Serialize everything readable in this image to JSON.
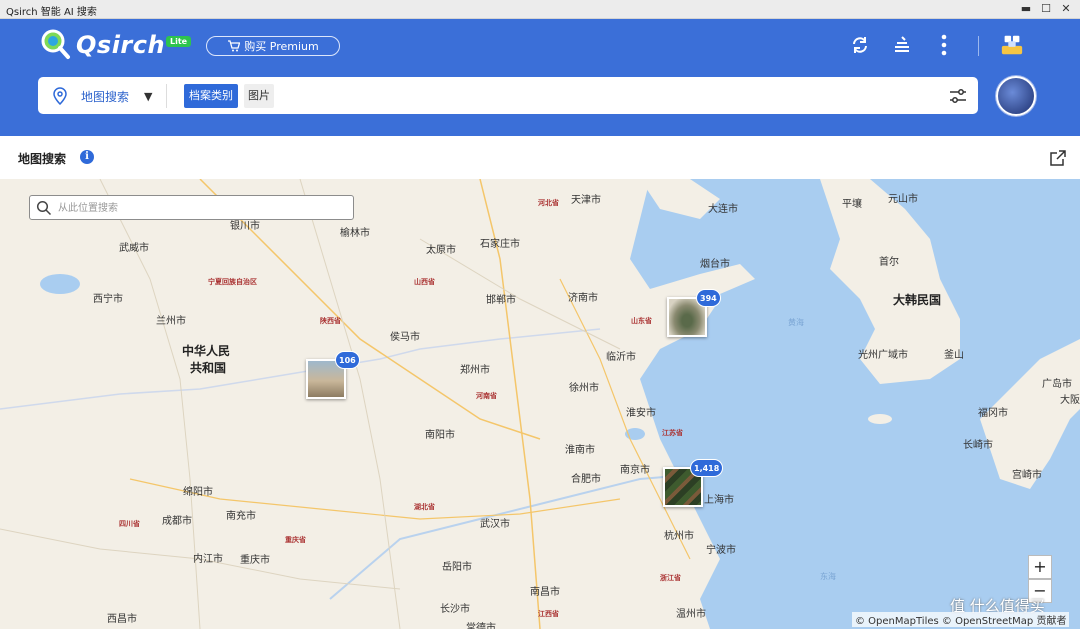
{
  "window": {
    "title": "Qsirch 智能 AI 搜索",
    "minimize": "▬",
    "maximize": "☐",
    "close": "✕"
  },
  "header": {
    "logo_text": "Qsirch",
    "lite_badge": "Lite",
    "premium_label": "购买 Premium",
    "icons": [
      "refresh-icon",
      "stack-icon",
      "more-icon",
      "app-store-icon"
    ]
  },
  "search": {
    "mode_label": "地图搜索",
    "chips": [
      {
        "label": "档案类别",
        "active": true
      },
      {
        "label": "图片",
        "active": false
      }
    ]
  },
  "map_panel": {
    "title": "地图搜索",
    "search_placeholder": "从此位置搜索",
    "clusters": [
      {
        "count": "106",
        "place": "cluster-shaanxi"
      },
      {
        "count": "394",
        "place": "cluster-shandong"
      },
      {
        "count": "1,418",
        "place": "cluster-shanghai"
      }
    ],
    "cities": [
      "天津市",
      "大连市",
      "元山市",
      "平壤",
      "银川市",
      "榆林市",
      "太原市",
      "石家庄市",
      "烟台市",
      "首尔",
      "武威市",
      "西宁市",
      "兰州市",
      "邯郸市",
      "济南市",
      "侯马市",
      "临沂市",
      "光州广域市",
      "釜山",
      "郑州市",
      "徐州市",
      "广岛市",
      "大阪市",
      "淮安市",
      "福冈市",
      "长崎市",
      "南阳市",
      "淮南市",
      "合肥市",
      "南京市",
      "上海市",
      "宫崎市",
      "绵阳市",
      "成都市",
      "南充市",
      "武汉市",
      "杭州市",
      "宁波市",
      "内江市",
      "重庆市",
      "岳阳市",
      "南昌市",
      "长沙市",
      "温州市",
      "西昌市",
      "常德市",
      "中华人民",
      "共和国",
      "大韩民国"
    ],
    "provinces": [
      "河北省",
      "宁夏回族自治区",
      "山西省",
      "陕西省",
      "山东省",
      "河南省",
      "江苏省",
      "湖北省",
      "四川省",
      "重庆省",
      "浙江省",
      "江西省"
    ],
    "seas": [
      "黄海",
      "东海"
    ],
    "zoom_in": "+",
    "zoom_out": "−",
    "attribution": "© OpenMapTiles © OpenStreetMap 贡献者",
    "watermark": "值 什么值得买"
  }
}
